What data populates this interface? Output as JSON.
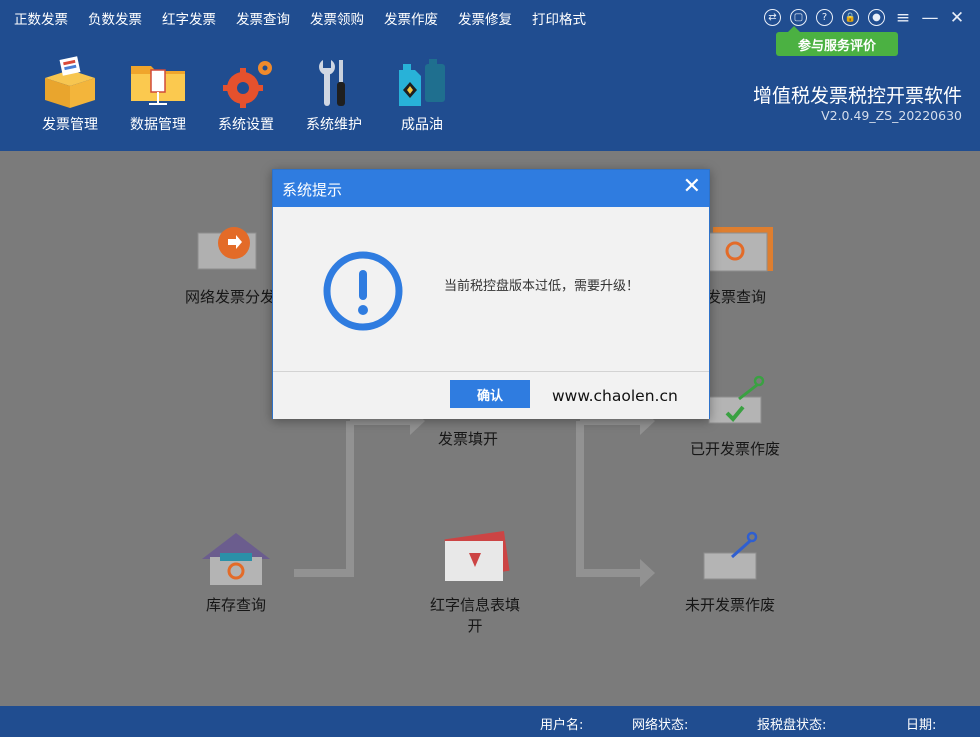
{
  "menu": [
    "正数发票",
    "负数发票",
    "红字发票",
    "发票查询",
    "发票领购",
    "发票作废",
    "发票修复",
    "打印格式"
  ],
  "window_controls": [
    {
      "name": "switch-icon",
      "glyph": "⇄"
    },
    {
      "name": "client-icon",
      "glyph": "▢"
    },
    {
      "name": "help-icon",
      "glyph": "?"
    },
    {
      "name": "lock-icon",
      "glyph": "🔒"
    },
    {
      "name": "user-icon",
      "glyph": "●"
    },
    {
      "name": "menu-icon",
      "glyph": "≡"
    },
    {
      "name": "minimize-icon",
      "glyph": "—"
    },
    {
      "name": "close-icon",
      "glyph": "✕"
    }
  ],
  "rate_button": "参与服务评价",
  "toolbar": {
    "invoice_mgmt": "发票管理",
    "data_mgmt": "数据管理",
    "system_settings": "系统设置",
    "system_maint": "系统维护",
    "refined_oil": "成品油"
  },
  "app": {
    "title": "增值税发票税控开票软件",
    "version": "V2.0.49_ZS_20220630"
  },
  "flow": {
    "network_dist": "网络发票分发",
    "issued_query": "已开发票查询",
    "issue_invoice": "发票填开",
    "issued_void": "已开发票作废",
    "stock_query": "库存查询",
    "red_info": "红字信息表填开",
    "unissued_void": "未开发票作废"
  },
  "status": {
    "user": "用户名:",
    "network": "网络状态:",
    "disk": "报税盘状态:",
    "date": "日期:"
  },
  "dialog": {
    "title": "系统提示",
    "message": "当前税控盘版本过低，需要升级！",
    "ok": "确认",
    "watermark": "www.chaolen.cn"
  },
  "colors": {
    "header": "#204d90",
    "dialog_title": "#2f7ce0",
    "rate_button": "#4bb142",
    "overlay": "#7b7b7b"
  }
}
